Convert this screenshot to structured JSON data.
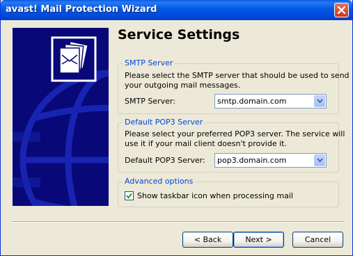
{
  "window": {
    "title": "avast! Mail Protection Wizard"
  },
  "page": {
    "heading": "Service Settings"
  },
  "smtp": {
    "legend": "SMTP Server",
    "description_line1": "Please select the SMTP server that should be used to send",
    "description_line2": "your outgoing mail messages.",
    "field_label": "SMTP Server:",
    "value": "smtp.domain.com"
  },
  "pop3": {
    "legend": "Default POP3 Server",
    "description_line1": "Please select your preferred POP3 server. The service will",
    "description_line2": "use it if your mail client doesn't provide it.",
    "field_label": "Default POP3 Server:",
    "value": "pop3.domain.com"
  },
  "advanced": {
    "legend": "Advanced options",
    "checkbox_label": "Show taskbar icon when processing mail",
    "checked": true
  },
  "buttons": {
    "back": "< Back",
    "next": "Next >",
    "cancel": "Cancel"
  },
  "icons": {
    "close": "close-icon",
    "mail_stack": "mail-stack-icon",
    "dropdown": "chevron-down-icon",
    "check": "check-icon"
  },
  "colors": {
    "titlebar": "#0058e6",
    "side_panel": "#080878",
    "legend_text": "#0046d5",
    "window_bg": "#ece9d8"
  }
}
